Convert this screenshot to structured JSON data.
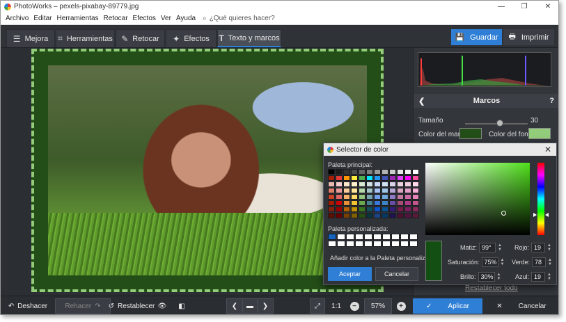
{
  "window": {
    "title": "PhotoWorks – pexels-pixabay-89779.jpg",
    "minimize": "—",
    "maximize": "❐",
    "close": "✕"
  },
  "menu": {
    "items": [
      "Archivo",
      "Editar",
      "Herramientas",
      "Retocar",
      "Efectos",
      "Ver",
      "Ayuda"
    ],
    "search_placeholder": "¿Qué quieres hacer?"
  },
  "tabs": [
    {
      "label": "Mejora",
      "icon": "sliders-icon",
      "glyph": "☰"
    },
    {
      "label": "Herramientas",
      "icon": "crop-icon",
      "glyph": "⌗"
    },
    {
      "label": "Retocar",
      "icon": "brush-icon",
      "glyph": "✎"
    },
    {
      "label": "Efectos",
      "icon": "magic-wand-icon",
      "glyph": "✦"
    },
    {
      "label": "Texto y marcos",
      "icon": "text-icon",
      "glyph": "T"
    }
  ],
  "toolbar": {
    "save_label": "Guardar",
    "save_glyph": "💾",
    "print_label": "Imprimir",
    "print_glyph": "🖶"
  },
  "panel": {
    "back_glyph": "❮",
    "title": "Marcos",
    "help_glyph": "?",
    "size_label": "Tamaño",
    "size_value": "30",
    "size_fraction": 0.55,
    "frame_color_label": "Color del marco:",
    "frame_color": "#234e18",
    "bg_color_label": "Color del fondo:",
    "bg_color": "#93cc7a",
    "reset_all": "Restablecer todo"
  },
  "dialog": {
    "title": "Selector de color",
    "close_glyph": "✕",
    "main_palette_label": "Paleta principal:",
    "custom_palette_label": "Paleta personalizada:",
    "add_custom": "Añadir color a la Paleta personalizada",
    "accept": "Aceptar",
    "cancel": "Cancelar",
    "hue_label": "Matiz:",
    "hue_value": "99°",
    "sat_label": "Saturación:",
    "sat_value": "75%",
    "bri_label": "Brillo:",
    "bri_value": "30%",
    "red_label": "Rojo:",
    "red_value": "19",
    "green_label": "Verde:",
    "green_value": "78",
    "blue_label": "Azul:",
    "blue_value": "19",
    "preview_color": "#134e13",
    "main_palette": [
      [
        "#000000",
        "#1a1a1a",
        "#333333",
        "#4d4d4d",
        "#666666",
        "#808080",
        "#999999",
        "#b3b3b3",
        "#cccccc",
        "#e6e6e6",
        "#f2f2f2",
        "#ffffff"
      ],
      [
        "#a61c00",
        "#e53935",
        "#ff9800",
        "#ffeb3b",
        "#4caf50",
        "#00e5ff",
        "#2196f3",
        "#3f51b5",
        "#9c27b0",
        "#e040fb",
        "#ff00ff",
        "#ff4fa0"
      ],
      [
        "#e6b8af",
        "#f4cccc",
        "#fce5cd",
        "#fff2cc",
        "#d9ead3",
        "#d0e0e3",
        "#c9daf8",
        "#cfe2f3",
        "#d9d2e9",
        "#ead1dc",
        "#f0d0e0",
        "#ffd9ec"
      ],
      [
        "#dd7e6b",
        "#ea9999",
        "#f9cb9c",
        "#ffe599",
        "#b6d7a8",
        "#a2c4c9",
        "#a4c2f4",
        "#9fc5e8",
        "#b4a7d6",
        "#d5a6bd",
        "#e3a0c8",
        "#f5b0d5"
      ],
      [
        "#cc4125",
        "#e06666",
        "#f6b26b",
        "#ffd966",
        "#93c47d",
        "#76a5af",
        "#6d9eeb",
        "#6fa8dc",
        "#8e7cc3",
        "#c27ba0",
        "#cf6aa8",
        "#e684b8"
      ],
      [
        "#a61c00",
        "#cc0000",
        "#e69138",
        "#f1c232",
        "#6aa84f",
        "#45818e",
        "#3c78d8",
        "#3d85c6",
        "#674ea7",
        "#a64d79",
        "#b03a8a",
        "#c2568f"
      ],
      [
        "#85200c",
        "#990000",
        "#b45f06",
        "#bf9000",
        "#38761d",
        "#134f5c",
        "#1155cc",
        "#0b5394",
        "#351c75",
        "#741b47",
        "#7a1f60",
        "#8a2a5c"
      ],
      [
        "#5b0f00",
        "#660000",
        "#783f04",
        "#7f6000",
        "#274e13",
        "#0c343d",
        "#1c4587",
        "#073763",
        "#20124d",
        "#4c1130",
        "#50143f",
        "#5a1a3c"
      ]
    ],
    "custom_palette": [
      [
        "#1565c0",
        "#ffffff",
        "#ffffff",
        "#ffffff",
        "#ffffff",
        "#ffffff",
        "#ffffff",
        "#ffffff",
        "#ffffff",
        "#ffffff"
      ],
      [
        "#ffffff",
        "#ffffff",
        "#ffffff",
        "#ffffff",
        "#ffffff",
        "#ffffff",
        "#ffffff",
        "#ffffff",
        "#ffffff",
        "#ffffff"
      ]
    ],
    "sv_saturation": 0.75,
    "sv_brightness": 0.3,
    "hue_fraction": 0.725
  },
  "bottom": {
    "undo": "Deshacer",
    "undo_glyph": "↶",
    "redo": "Rehacer",
    "redo_glyph": "↷",
    "reset": "Restablecer",
    "reset_glyph": "↺",
    "eye_glyph": "👁",
    "compare_glyph": "◧",
    "prev_glyph": "❮",
    "folder_glyph": "▬",
    "next_glyph": "❯",
    "fit_glyph": "⤢",
    "ratio": "1:1",
    "zoom_out_glyph": "−",
    "zoom": "57%",
    "zoom_in_glyph": "+",
    "apply": "Aplicar",
    "apply_glyph": "✓",
    "cancel": "Cancelar",
    "cancel_glyph": "✕"
  }
}
